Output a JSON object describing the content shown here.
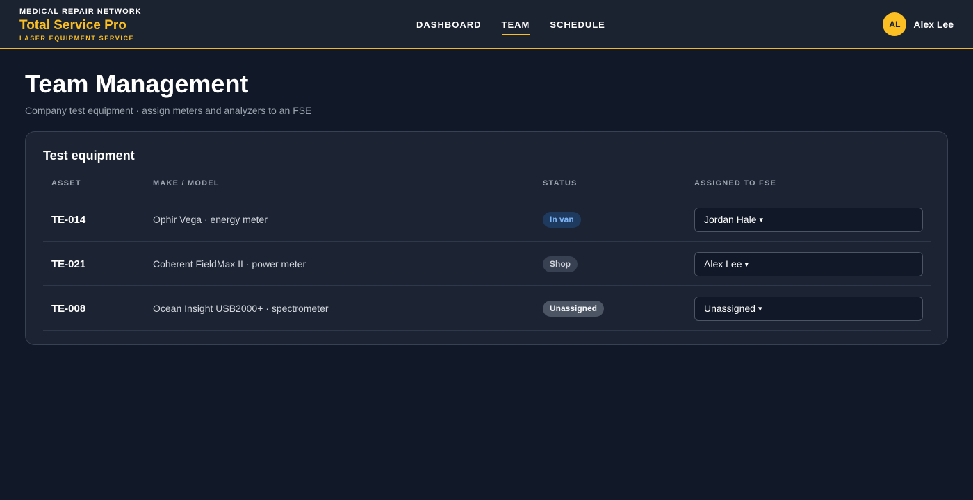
{
  "brand": {
    "network": "MEDICAL REPAIR NETWORK",
    "name": "Total Service Pro",
    "tagline": "LASER EQUIPMENT SERVICE",
    "accent_color": "#fbbf24"
  },
  "nav": {
    "items": [
      {
        "label": "DASHBOARD"
      },
      {
        "label": "TEAM",
        "active": true
      },
      {
        "label": "SCHEDULE"
      }
    ]
  },
  "user": {
    "initials": "AL",
    "name": "Alex Lee"
  },
  "page": {
    "title": "Team Management",
    "subtitle": "Company test equipment · assign meters and analyzers to an FSE"
  },
  "equipment": {
    "title": "Test equipment",
    "columns": [
      "ASSET",
      "MAKE / MODEL",
      "STATUS",
      "ASSIGNED TO FSE"
    ],
    "rows": [
      {
        "asset": "TE-014",
        "model": "Ophir Vega · energy meter",
        "status": "In van",
        "assigned": "Jordan Hale"
      },
      {
        "asset": "TE-021",
        "model": "Coherent FieldMax II · power meter",
        "status": "Shop",
        "assigned": "Alex Lee"
      },
      {
        "asset": "TE-008",
        "model": "Ocean Insight USB2000+ · spectrometer",
        "status": "Unassigned",
        "assigned": "Unassigned"
      }
    ],
    "caret_glyph": "▾"
  }
}
